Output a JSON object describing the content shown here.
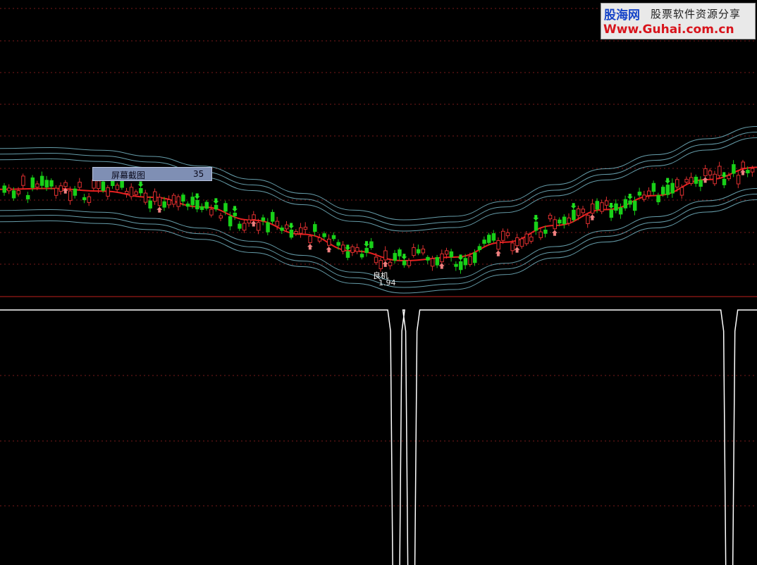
{
  "watermark": {
    "brand": "股海网",
    "tagline": "股票软件资源分享",
    "url": "Www.Guhai.com.cn"
  },
  "tooltip": {
    "label": "屏幕截图",
    "value": "35"
  },
  "signal": {
    "label": "良机",
    "value": "1.94"
  },
  "colors": {
    "background": "#000000",
    "grid": "#7a1a1a",
    "divider": "#c0201c",
    "ma_line": "#e81f1f",
    "bands": "#78b8c8",
    "up_candle": "#e03030",
    "down_candle": "#18d018",
    "buy_arrow": "#f08080",
    "sell_arrow": "#20e020",
    "indicator_line": "#ffffff"
  },
  "chart_data": {
    "type": "candlestick",
    "title": "",
    "xlabel": "",
    "ylabel": "",
    "series": [
      {
        "name": "",
        "type": "line",
        "color": "#e81f1f",
        "values": [
          46.5,
          46.6,
          46.3,
          45.6,
          44.5,
          43.0,
          41.4,
          39.5,
          38.4,
          38.8,
          40.5,
          42.4,
          44.2,
          45.8,
          47.6,
          49.0
        ]
      },
      {
        "name": "",
        "type": "candles",
        "count": 160
      }
    ],
    "indicator": {
      "type": "step",
      "levels": [
        "high",
        "low"
      ],
      "spikes_at_fraction": [
        0.515,
        0.535,
        0.955
      ]
    },
    "markers": [
      {
        "kind": "buy",
        "label": "良机",
        "value": 1.94
      }
    ],
    "grid": true,
    "legend": "none"
  }
}
